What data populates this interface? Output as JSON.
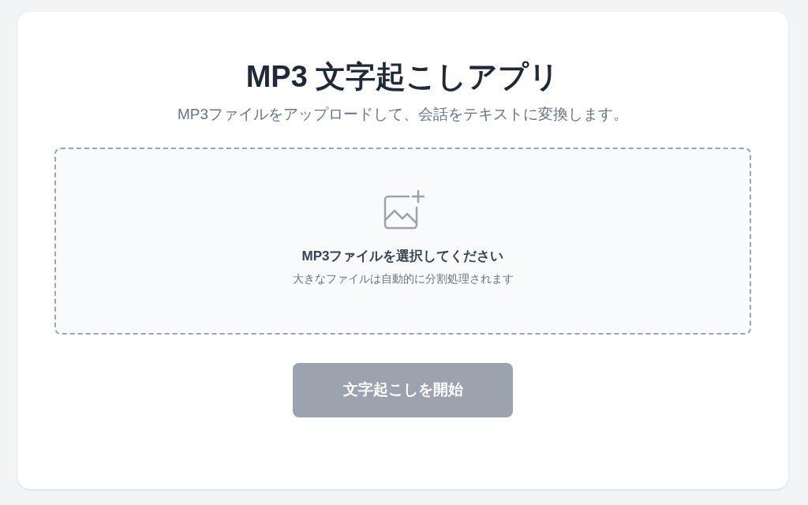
{
  "title": "MP3 文字起こしアプリ",
  "subtitle": "MP3ファイルをアップロードして、会話をテキストに変換します。",
  "dropzone": {
    "label": "MP3ファイルを選択してください",
    "hint": "大きなファイルは自動的に分割処理されます"
  },
  "button": {
    "label": "文字起こしを開始",
    "disabled": true
  }
}
